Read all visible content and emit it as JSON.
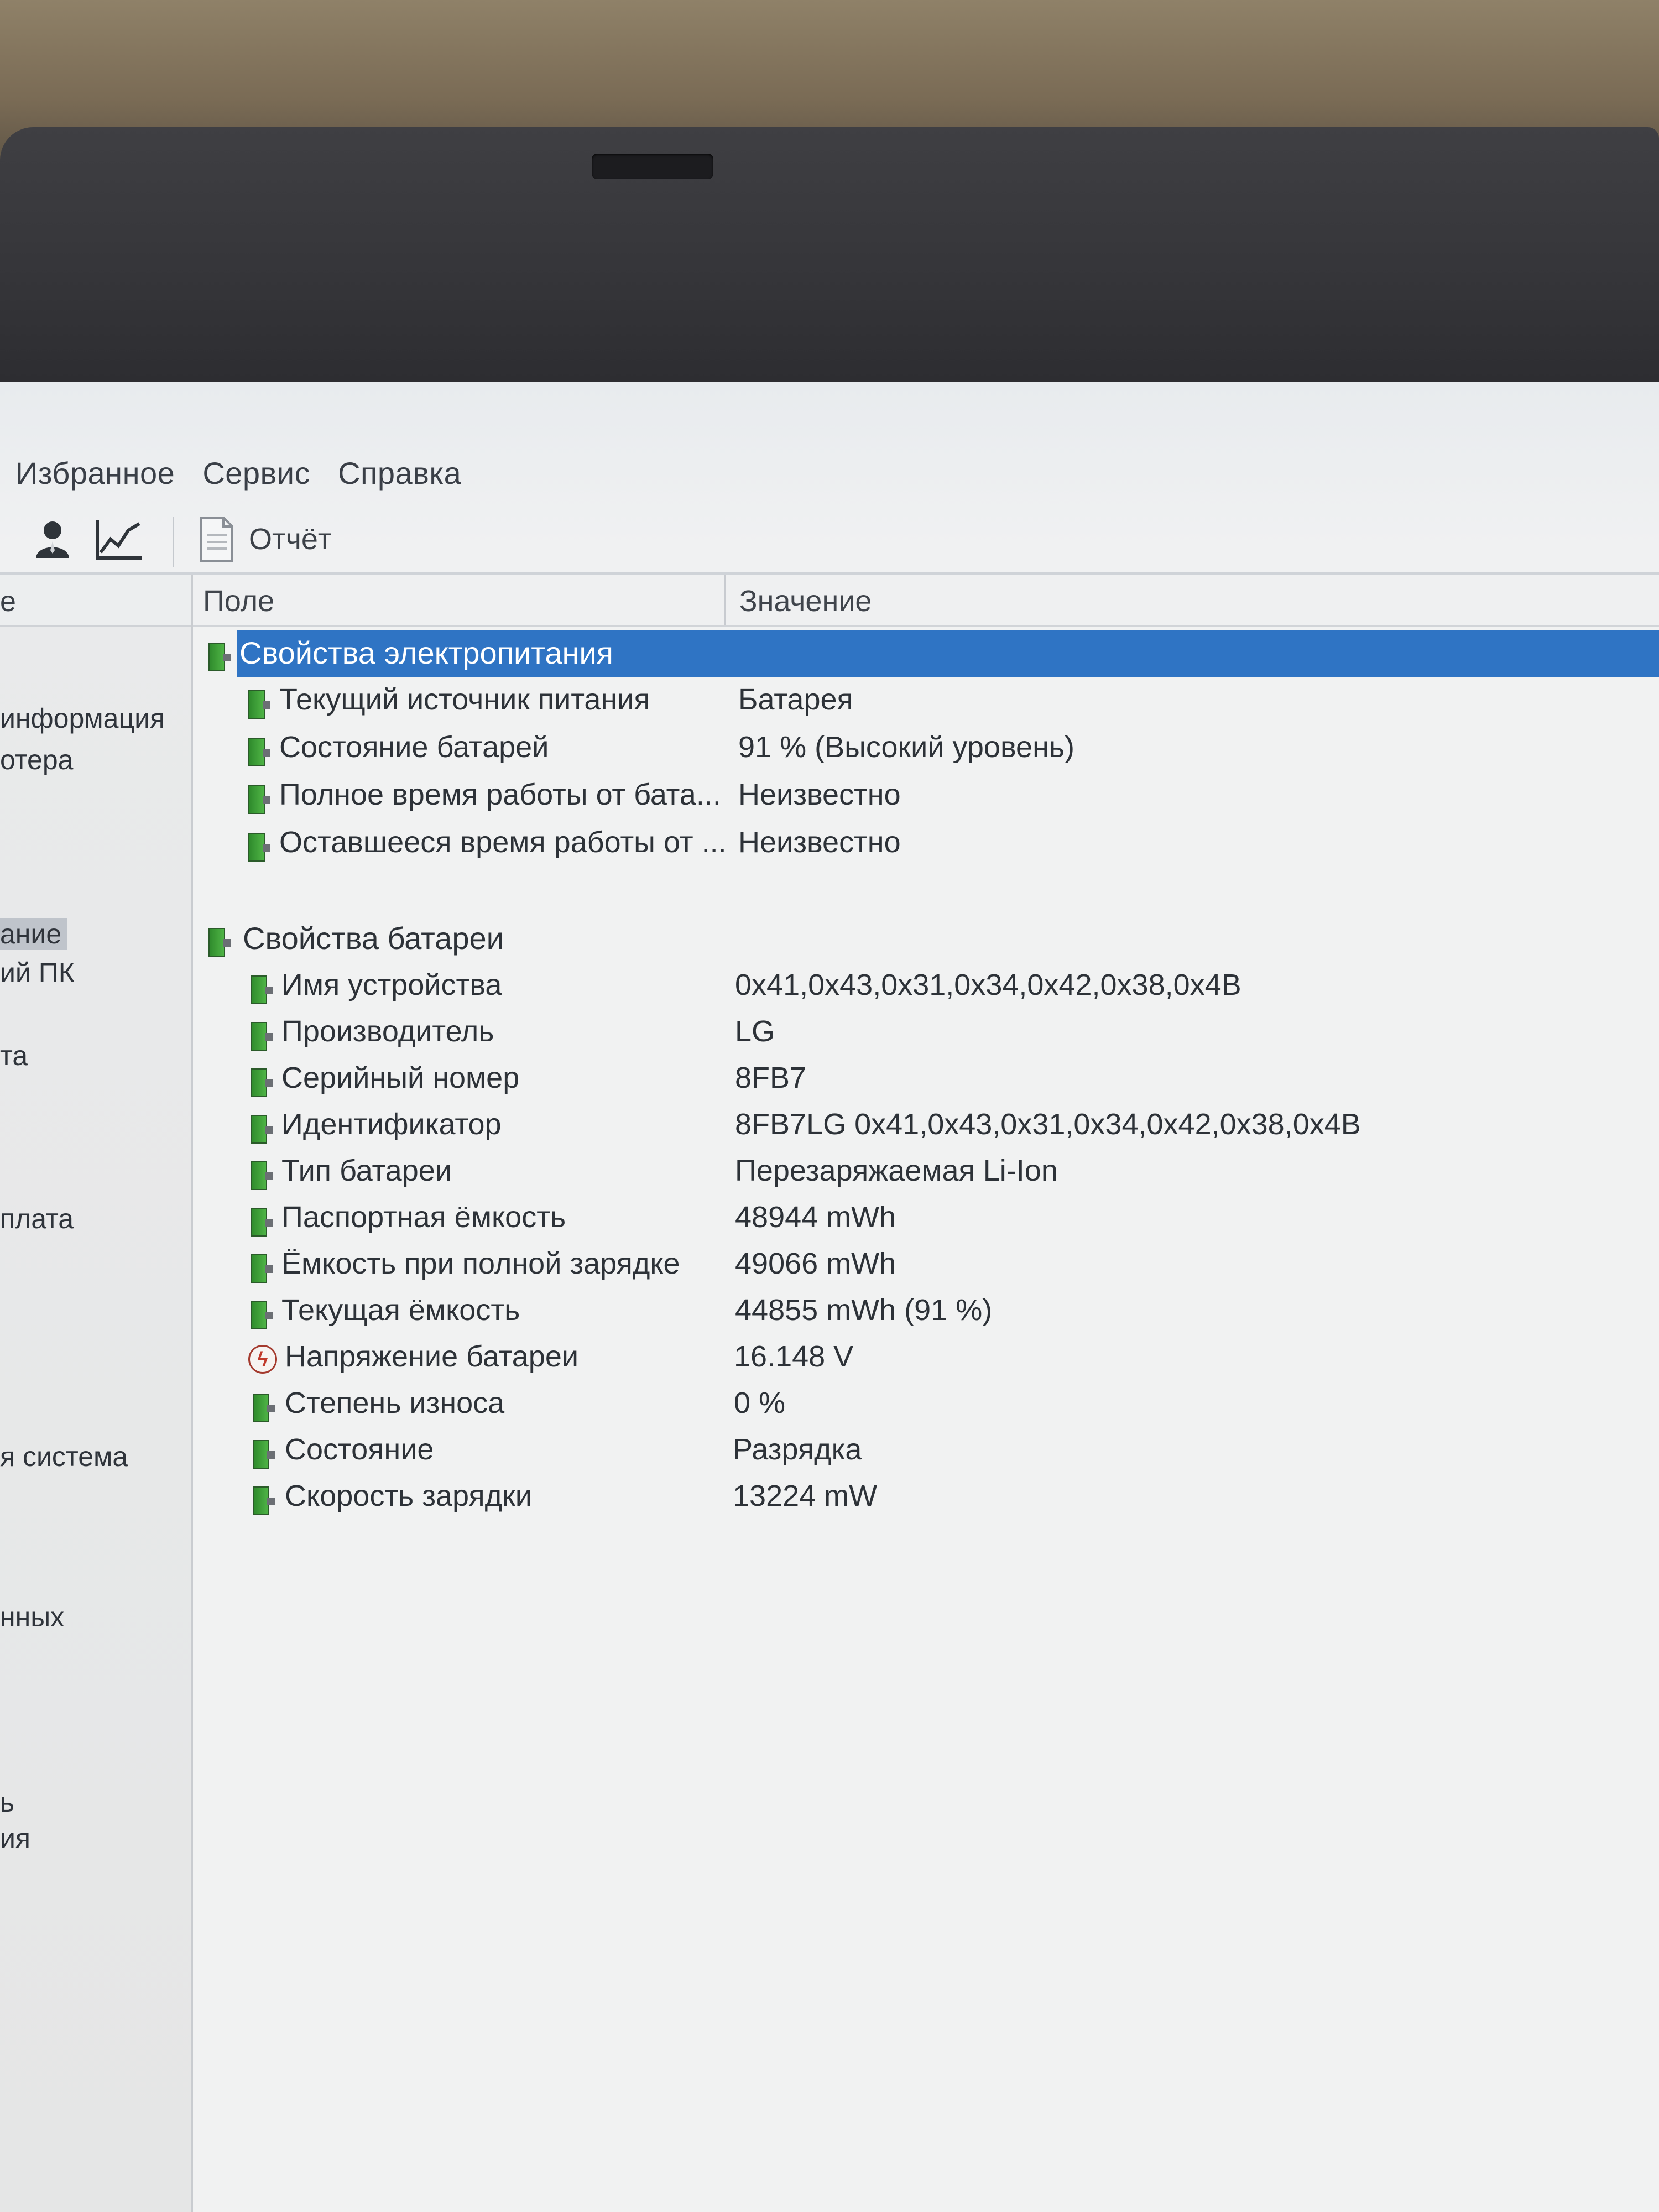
{
  "menu": [
    "Избранное",
    "Сервис",
    "Справка"
  ],
  "toolbar": {
    "user_icon": "user-icon",
    "chart_icon": "chart-line-icon",
    "report_icon": "document-icon",
    "report_label": "Отчёт"
  },
  "sidebar": {
    "header": "е",
    "items": [
      "информация",
      "отера",
      "ание",
      "ий ПК",
      "та",
      "плата",
      "я система",
      "нных",
      "ь",
      "ия"
    ],
    "selected_index": 2
  },
  "grid": {
    "columns": [
      "Поле",
      "Значение"
    ],
    "groups": [
      {
        "title": "Свойства электропитания",
        "selected": true,
        "rows": [
          {
            "field": "Текущий источник питания",
            "value": "Батарея",
            "icon": "battery-icon"
          },
          {
            "field": "Состояние батарей",
            "value": "91 % (Высокий уровень)",
            "icon": "battery-icon"
          },
          {
            "field": "Полное время работы от бата...",
            "value": "Неизвестно",
            "icon": "battery-icon"
          },
          {
            "field": "Оставшееся время работы от ...",
            "value": "Неизвестно",
            "icon": "battery-icon"
          }
        ]
      },
      {
        "title": "Свойства батареи",
        "selected": false,
        "rows": [
          {
            "field": "Имя устройства",
            "value": "0x41,0x43,0x31,0x34,0x42,0x38,0x4B",
            "icon": "battery-icon"
          },
          {
            "field": "Производитель",
            "value": "LG",
            "icon": "battery-icon"
          },
          {
            "field": "Серийный номер",
            "value": "8FB7",
            "icon": "battery-icon"
          },
          {
            "field": "Идентификатор",
            "value": "8FB7LG 0x41,0x43,0x31,0x34,0x42,0x38,0x4B",
            "icon": "battery-icon"
          },
          {
            "field": "Тип батареи",
            "value": "Перезаряжаемая Li-Ion",
            "icon": "battery-icon"
          },
          {
            "field": "Паспортная ёмкость",
            "value": "48944 mWh",
            "icon": "battery-icon"
          },
          {
            "field": "Ёмкость при полной зарядке",
            "value": "49066 mWh",
            "icon": "battery-icon"
          },
          {
            "field": "Текущая ёмкость",
            "value": "44855 mWh  (91 %)",
            "icon": "battery-icon"
          },
          {
            "field": "Напряжение батареи",
            "value": "16.148 V",
            "icon": "voltage-icon"
          },
          {
            "field": "Степень износа",
            "value": "0 %",
            "icon": "battery-icon"
          },
          {
            "field": "Состояние",
            "value": "Разрядка",
            "icon": "battery-icon"
          },
          {
            "field": "Скорость зарядки",
            "value": "13224 mW",
            "icon": "battery-icon"
          }
        ]
      }
    ]
  },
  "colors": {
    "selection": "#2f74c4",
    "battery_green": "#3fa13a"
  }
}
